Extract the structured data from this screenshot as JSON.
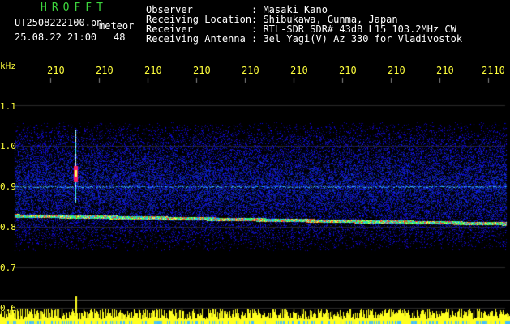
{
  "header": {
    "brand": "HROFFT",
    "filename": "UT2508222100.pn",
    "type": "meteor",
    "datetime": "25.08.22 21:00",
    "count": "48",
    "observer_label": "Observer",
    "observer_value": ": Masaki Kano",
    "location_label": "Receiving Location",
    "location_value": ": Shibukawa, Gunma, Japan",
    "receiver_label": "Receiver",
    "receiver_value": ": RTL-SDR SDR# 43dB L15 103.2MHz CW",
    "antenna_label": "Receiving Antenna",
    "antenna_value": ": 3el Yagi(V) Az 330 for Vladivostok"
  },
  "axes": {
    "y_unit": "kHz",
    "y_ticks": [
      "1.1",
      "1.0",
      "0.9",
      "0.8",
      "0.7",
      "0.6"
    ],
    "x_ticks": [
      "210",
      "210",
      "210",
      "210",
      "210",
      "210",
      "210",
      "210",
      "210",
      "2110"
    ]
  },
  "colors": {
    "text_yellow": "#ffff3c",
    "brand_green": "#3dd63d",
    "background": "#000000",
    "noise_blue": "#1a3cff"
  }
}
